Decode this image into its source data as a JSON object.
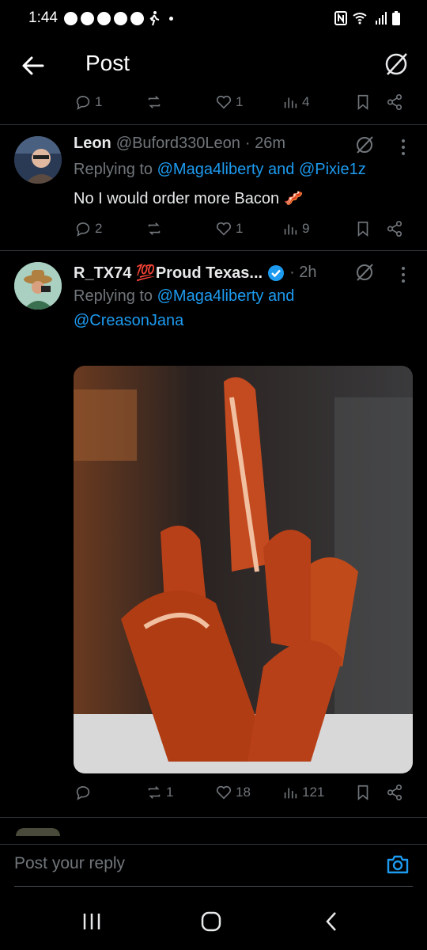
{
  "status_bar": {
    "time": "1:44"
  },
  "header": {
    "title": "Post"
  },
  "prev_post_actions": {
    "replies": "1",
    "reposts": "",
    "likes": "1",
    "views": "4"
  },
  "posts": [
    {
      "name": "Leon",
      "handle": "@Buford330Leon",
      "time": "· 26m",
      "replying_prefix": "Replying to",
      "mentions": [
        "@Maga4liberty",
        "@Pixie1z"
      ],
      "mention_joiner": "and",
      "text": "No I would order more Bacon 🥓",
      "actions": {
        "replies": "2",
        "reposts": "",
        "likes": "1",
        "views": "9"
      }
    },
    {
      "name": "R_TX74 💯Proud Texas...",
      "verified": true,
      "time": "· 2h",
      "replying_prefix": "Replying to",
      "mentions": [
        "@Maga4liberty",
        "@CreasonJana"
      ],
      "mention_joiner": "and",
      "image_description_icon": "bacon-image",
      "actions": {
        "replies": "",
        "reposts": "1",
        "likes": "18",
        "views": "121"
      }
    }
  ],
  "composer": {
    "placeholder": "Post your reply"
  },
  "colors": {
    "background": "#000000",
    "accent": "#1d9bf0",
    "muted": "#71767b",
    "text": "#e7e9ea"
  }
}
